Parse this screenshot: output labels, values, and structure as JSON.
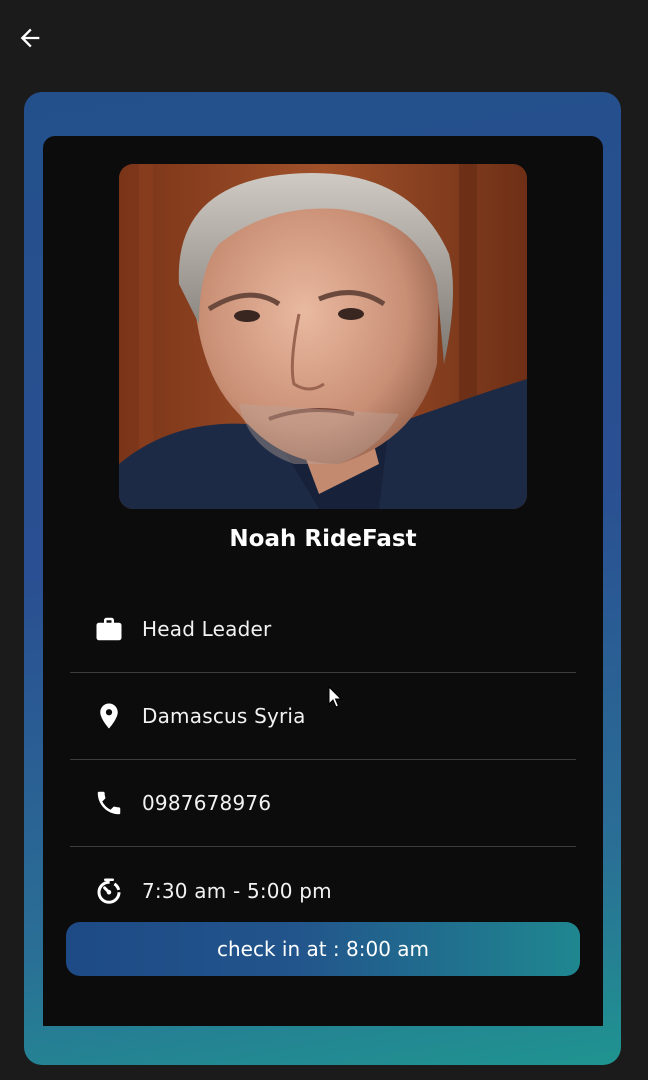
{
  "header": {
    "back_icon": "arrow-left-icon"
  },
  "colors": {
    "background": "#1b1b1b",
    "card": "#0c0c0d",
    "gradient_start": "#23508b",
    "gradient_end": "#1f9490",
    "text": "#ffffff",
    "divider": "#3d3d3f"
  },
  "profile": {
    "photo_icon": "profile-photo",
    "name": "Noah RideFast",
    "details": [
      {
        "icon": "briefcase-icon",
        "text": "Head Leader"
      },
      {
        "icon": "location-pin-icon",
        "text": "Damascus Syria"
      },
      {
        "icon": "phone-icon",
        "text": "0987678976"
      },
      {
        "icon": "timer-icon",
        "text": "7:30 am - 5:00 pm"
      }
    ]
  },
  "action": {
    "checkin_label": "check in at : 8:00 am"
  }
}
